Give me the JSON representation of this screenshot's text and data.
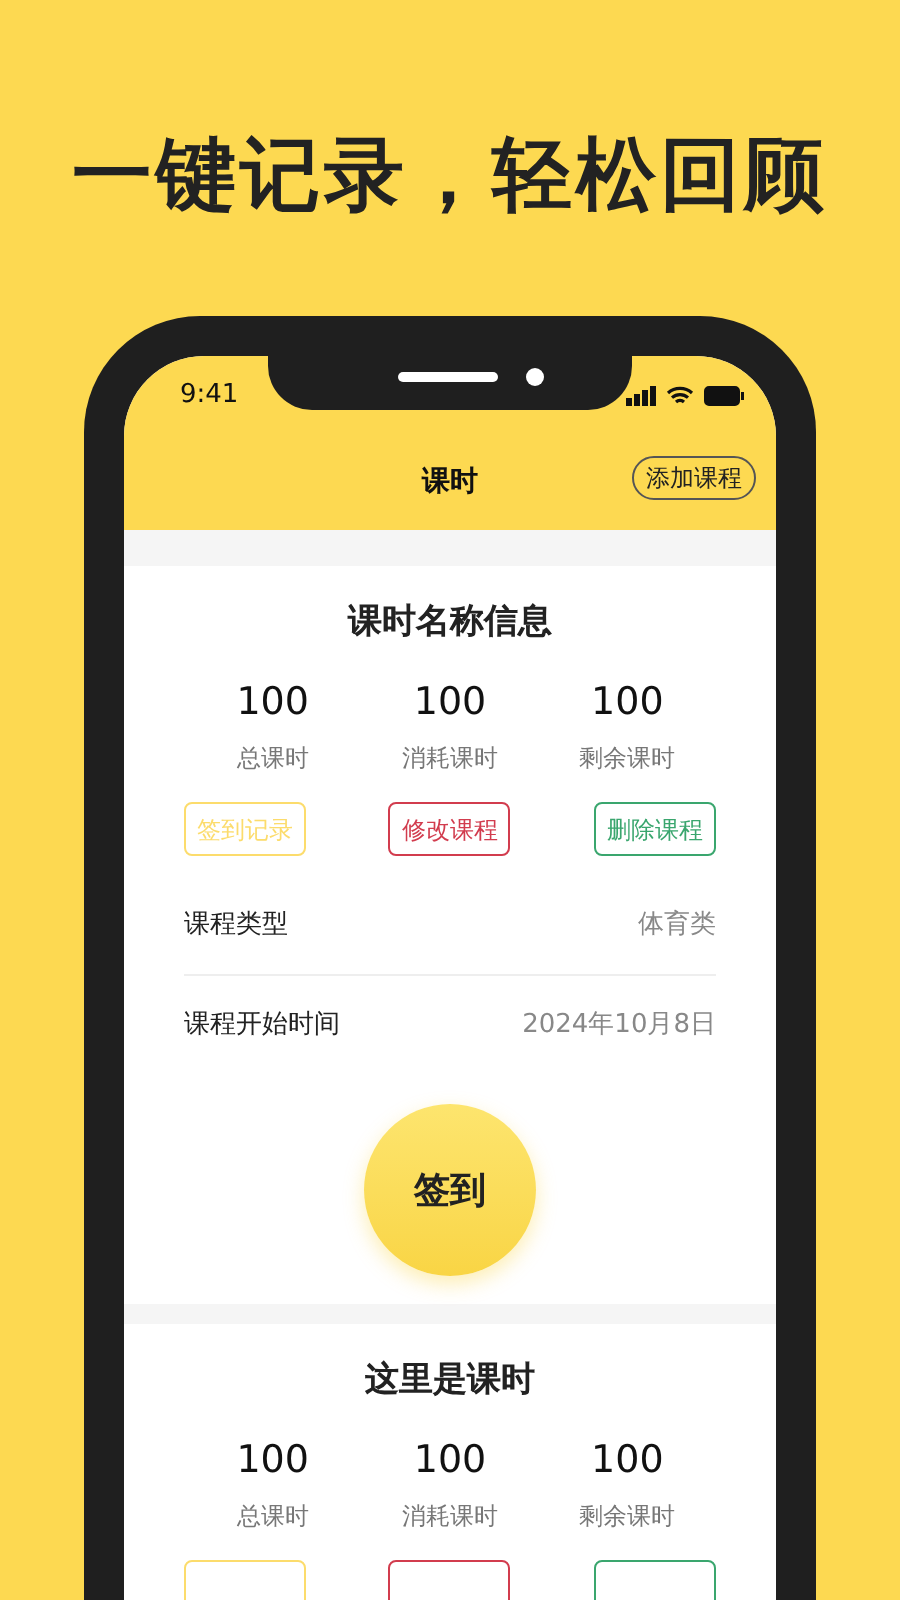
{
  "headline": "一键记录，轻松回顾",
  "status_bar": {
    "time": "9:41"
  },
  "nav": {
    "title": "课时",
    "action": "添加课程"
  },
  "cards": [
    {
      "title": "课时名称信息",
      "stats": [
        {
          "value": "100",
          "label": "总课时"
        },
        {
          "value": "100",
          "label": "消耗课时"
        },
        {
          "value": "100",
          "label": "剩余课时"
        }
      ],
      "actions": [
        {
          "label": "签到记录",
          "color": "#fcdc6c"
        },
        {
          "label": "修改课程",
          "color": "#d23c4e"
        },
        {
          "label": "删除课程",
          "color": "#3aa66e"
        }
      ],
      "fields": [
        {
          "label": "课程类型",
          "value": "体育类"
        },
        {
          "label": "课程开始时间",
          "value": "2024年10月8日"
        }
      ],
      "checkin_button": "签到"
    },
    {
      "title": "这里是课时",
      "stats": [
        {
          "value": "100",
          "label": "总课时"
        },
        {
          "value": "100",
          "label": "消耗课时"
        },
        {
          "value": "100",
          "label": "剩余课时"
        }
      ],
      "actions": [
        {
          "color": "#fcdc6c"
        },
        {
          "color": "#d23c4e"
        },
        {
          "color": "#3aa66e"
        }
      ]
    }
  ]
}
